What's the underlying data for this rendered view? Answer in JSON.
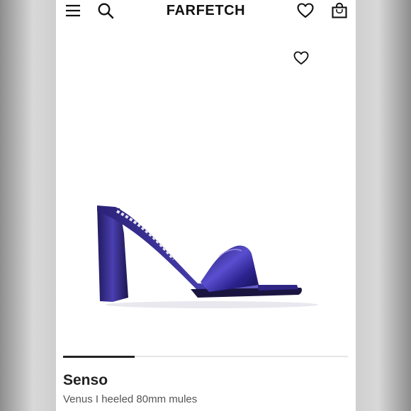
{
  "header": {
    "logo": "FARFETCH",
    "icons": [
      "menu-icon",
      "search-icon",
      "wishlist-icon",
      "bag-icon"
    ]
  },
  "product": {
    "brand": "Senso",
    "name": "Venus I heeled 80mm mules",
    "image_alt": "purple metallic heeled mule",
    "wishlist_icon": "heart-outline-icon"
  },
  "carousel": {
    "progress": 0.25
  },
  "colors": {
    "accent_dark": "#111111",
    "shoe_purple": "#3b2a8c",
    "progress_bar": "#222222"
  }
}
